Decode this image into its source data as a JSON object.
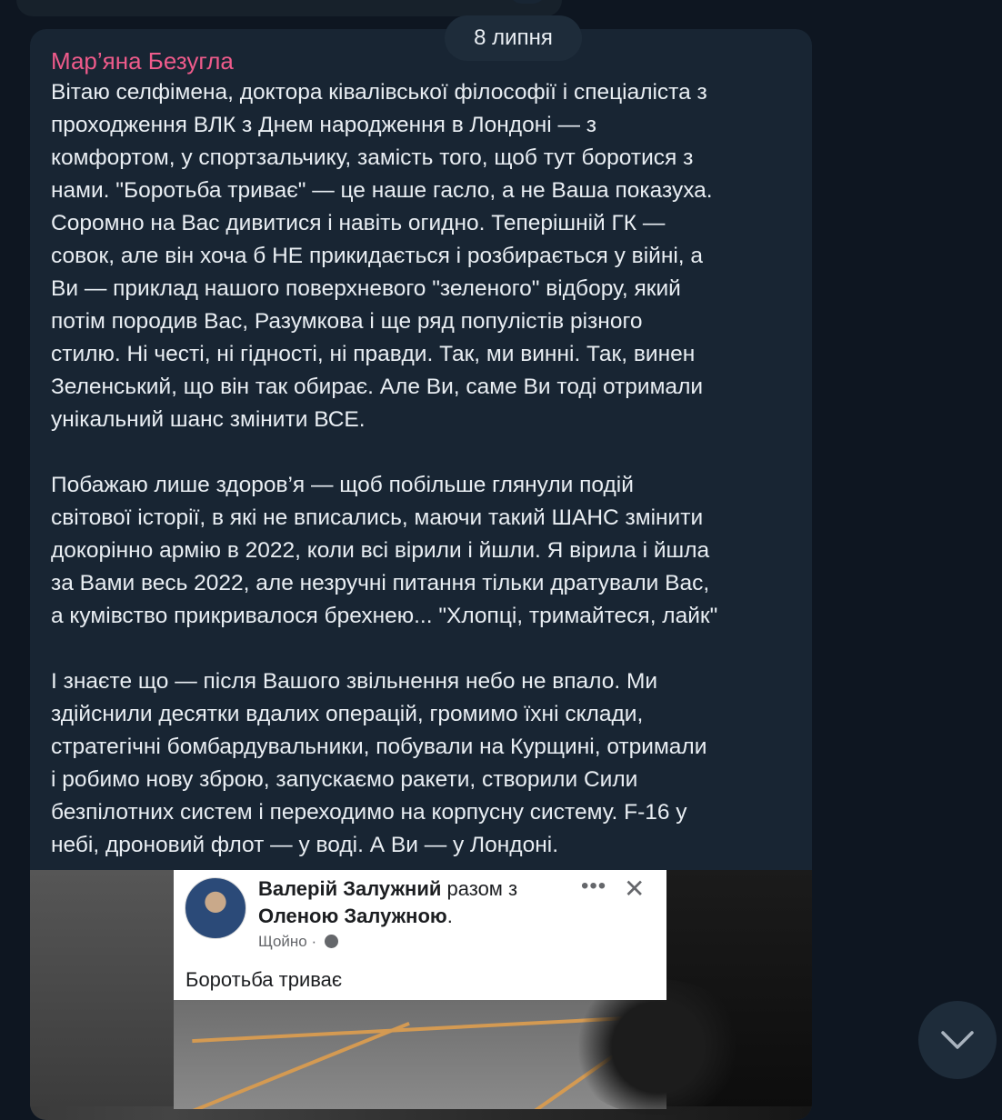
{
  "date_separator": "8 липня",
  "message": {
    "sender": "Мар’яна Безугла",
    "paragraphs": [
      "Вітаю селфімена, доктора ківалівської філософії і спеціаліста з\nпроходження ВЛК з Днем народження в Лондоні — з\nкомфортом, у спортзальчику, замість того, щоб тут боротися з\nнами. \"Боротьба триває\" — це наше гасло, а не Ваша показуха.\nСоромно на Вас дивитися і навіть огидно. Теперішній ГК —\nсовок, але він хоча б НЕ прикидається і розбирається у війні, а\nВи — приклад нашого поверхневого \"зеленого\" відбору, який\nпотім породив Вас, Разумкова і ще ряд популістів різного\nстилю. Ні честі, ні гідності, ні правди. Так, ми винні. Так, винен\nЗеленський, що він так обирає. Але Ви, саме Ви тоді отримали\nунікальний шанс змінити ВСЕ.",
      "Побажаю лише здоров’я — щоб побільше глянули подій\nсвітової історії, в які не вписались, маючи такий ШАНС змінити\nдокорінно армію в 2022, коли всі вірили і йшли. Я вірила і йшла\nза Вами весь 2022, але незручні питання тільки дратували Вас,\nа кумівство прикривалося брехнею... \"Хлопці, тримайтеся, лайк\"",
      "І знаєте що — після Вашого звільнення небо не впало. Ми\nздійснили десятки вдалих операцій, громимо їхні склади,\nстратегічні бомбардувальники, побували на Курщині, отримали\nі робимо нову зброю, запускаємо ракети, створили Сили\nбезпілотних систем і переходимо на корпусну систему. F-16 у\nнебі, дроновий флот — у воді. А Ви — у Лондоні."
    ]
  },
  "embedded_post": {
    "author": "Валерій Залужний",
    "with_text": "разом з",
    "tagged": "Оленою Залужною",
    "tagged_suffix": ".",
    "time": "Щойно",
    "separator": "·",
    "text": "Боротьба триває",
    "dots": "•••",
    "close": "✕"
  },
  "colors": {
    "background": "#0e1621",
    "bubble": "#182533",
    "sender": "#ef5b8b",
    "text": "#e9eef3"
  }
}
